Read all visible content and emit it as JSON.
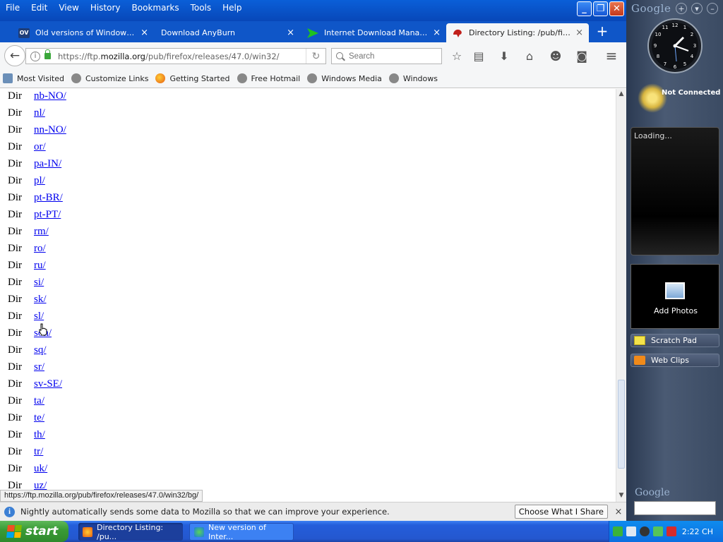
{
  "menu": [
    "File",
    "Edit",
    "View",
    "History",
    "Bookmarks",
    "Tools",
    "Help"
  ],
  "window_controls": {
    "minimize": "_",
    "restore": "❐",
    "close": "✕"
  },
  "tabs": [
    {
      "title": "Old versions of Windows, M...",
      "favicon": "OV",
      "close": "×"
    },
    {
      "title": "Download AnyBurn",
      "close": "×"
    },
    {
      "title": "Internet Download Manager...",
      "close": "×"
    },
    {
      "title": "Directory Listing: /pub/firefo...",
      "close": "×",
      "active": true
    }
  ],
  "new_tab": "+",
  "navbar": {
    "back": "←",
    "url_prefix": "https://ftp.",
    "url_domain": "mozilla.org",
    "url_path": "/pub/firefox/releases/47.0/win32/",
    "reload": "↻",
    "search_placeholder": "Search",
    "tools": [
      "star-icon",
      "reader-list-icon",
      "download-icon",
      "home-icon",
      "hello-icon",
      "pocket-icon",
      "menu-icon"
    ],
    "tool_glyphs": [
      "☆",
      "▤",
      "⬇",
      "⌂",
      "☻",
      "◙",
      "≡"
    ]
  },
  "bookmarks": [
    "Most Visited",
    "Customize Links",
    "Getting Started",
    "Free Hotmail",
    "Windows Media",
    "Windows"
  ],
  "listing": {
    "type_label": "Dir",
    "dirs": [
      "nb-NO/",
      "nl/",
      "nn-NO/",
      "or/",
      "pa-IN/",
      "pl/",
      "pt-BR/",
      "pt-PT/",
      "rm/",
      "ro/",
      "ru/",
      "si/",
      "sk/",
      "sl/",
      "son/",
      "sq/",
      "sr/",
      "sv-SE/",
      "ta/",
      "te/",
      "th/",
      "tr/",
      "uk/",
      "uz/"
    ]
  },
  "status_url": "https://ftp.mozilla.org/pub/firefox/releases/47.0/win32/bg/",
  "notification": {
    "icon": "i",
    "text": "Nightly automatically sends some data to Mozilla so that we can improve your experience.",
    "button": "Choose What I Share",
    "close": "×"
  },
  "google_sidebar": {
    "logo": "Google",
    "controls": [
      "+",
      "▾",
      "–"
    ],
    "weather": "Not Connected",
    "loading": "Loading...",
    "photos_label": "Add Photos",
    "bars": [
      "Scratch Pad",
      "Web Clips"
    ],
    "search_logo": "Google"
  },
  "taskbar": {
    "start": "start",
    "tasks": [
      "Directory Listing: /pu...",
      "New version of Inter..."
    ],
    "clock": "2:22 CH"
  }
}
